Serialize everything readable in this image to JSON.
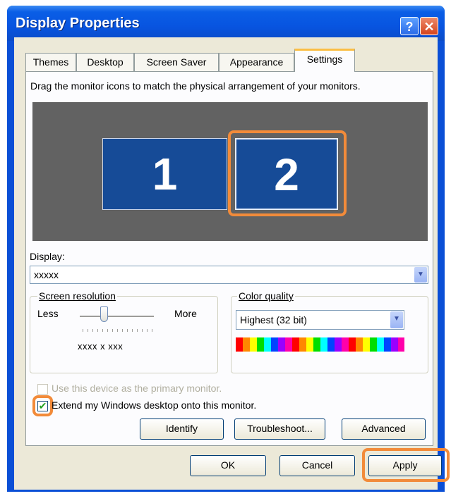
{
  "window": {
    "title": "Display Properties",
    "help_glyph": "?",
    "close_glyph": "✕"
  },
  "tabs": [
    {
      "label": "Themes"
    },
    {
      "label": "Desktop"
    },
    {
      "label": "Screen Saver"
    },
    {
      "label": "Appearance"
    },
    {
      "label": "Settings",
      "active": true
    }
  ],
  "instructions": "Drag the monitor icons to match the physical arrangement of your monitors.",
  "monitors": [
    {
      "label": "1"
    },
    {
      "label": "2",
      "selected": true
    }
  ],
  "display": {
    "label": "Display:",
    "value": "xxxxx"
  },
  "resolution": {
    "label": "Screen resolution",
    "less": "Less",
    "more": "More",
    "value": "xxxx  x  xxx"
  },
  "color_quality": {
    "label": "Color quality",
    "value": "Highest (32 bit)"
  },
  "options": {
    "primary_label": "Use this device as the primary monitor.",
    "primary_checked": false,
    "extend_label": "Extend my Windows desktop onto this monitor.",
    "extend_checked": true
  },
  "buttons": {
    "identify": "Identify",
    "troubleshoot": "Troubleshoot...",
    "advanced": "Advanced",
    "ok": "OK",
    "cancel": "Cancel",
    "apply": "Apply"
  },
  "colors": {
    "highlight": "#f28b3a",
    "monitor_fill": "#164b97",
    "title_bar": "#0a5ee6"
  }
}
